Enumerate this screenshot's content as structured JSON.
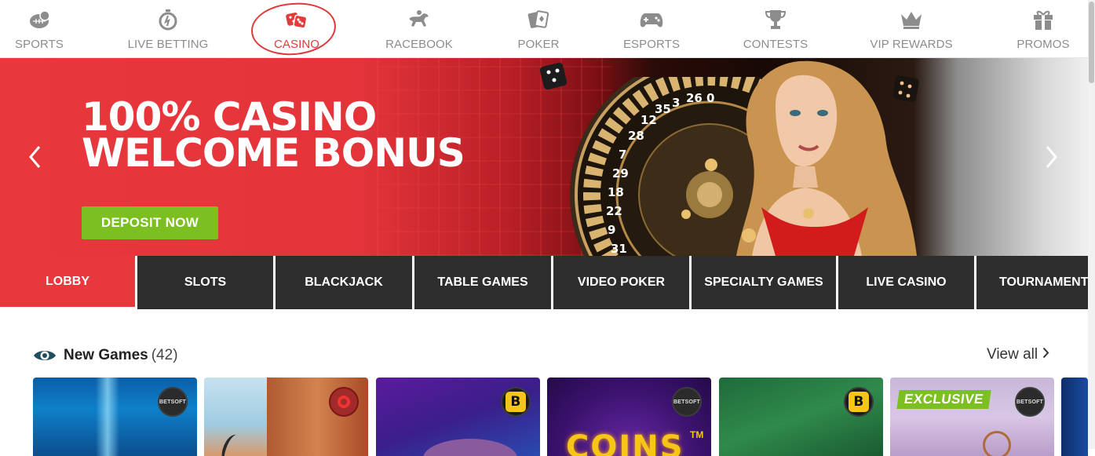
{
  "nav": {
    "items": [
      {
        "label": "SPORTS",
        "icon": "sports-ball-icon"
      },
      {
        "label": "LIVE BETTING",
        "icon": "stopwatch-icon"
      },
      {
        "label": "CASINO",
        "icon": "dice-icon",
        "active": true
      },
      {
        "label": "RACEBOOK",
        "icon": "horse-racing-icon"
      },
      {
        "label": "POKER",
        "icon": "playing-cards-icon"
      },
      {
        "label": "ESPORTS",
        "icon": "gamepad-icon"
      },
      {
        "label": "CONTESTS",
        "icon": "trophy-icon"
      },
      {
        "label": "VIP REWARDS",
        "icon": "crown-icon"
      },
      {
        "label": "PROMOS",
        "icon": "gift-icon"
      }
    ],
    "active_color": "#e23b3b",
    "inactive_color": "#8c8c8c"
  },
  "hero": {
    "title_line1": "100% CASINO",
    "title_line2": "WELCOME BONUS",
    "cta_label": "DEPOSIT NOW",
    "cta_color": "#7cbf20",
    "bg_color": "#e8383c",
    "prev_icon": "chevron-left-icon",
    "next_icon": "chevron-right-icon",
    "roulette_numbers": [
      "0",
      "26",
      "3",
      "35",
      "12",
      "28",
      "7",
      "29",
      "18",
      "22",
      "9",
      "31"
    ]
  },
  "tabs": [
    {
      "label": "LOBBY",
      "active": true
    },
    {
      "label": "SLOTS"
    },
    {
      "label": "BLACKJACK"
    },
    {
      "label": "TABLE GAMES"
    },
    {
      "label": "VIDEO POKER"
    },
    {
      "label": "SPECIALTY GAMES"
    },
    {
      "label": "LIVE CASINO"
    },
    {
      "label": "TOURNAMENTS"
    }
  ],
  "section": {
    "title": "New Games",
    "count": "(42)",
    "view_all": "View all",
    "icon": "eye-icon"
  },
  "cards": [
    {
      "provider": "BETSOFT",
      "badge_type": "betsoft"
    },
    {
      "provider": "",
      "badge_type": "red-ring"
    },
    {
      "provider": "B",
      "badge_type": "b"
    },
    {
      "provider": "BETSOFT",
      "badge_type": "betsoft",
      "art_text": "COINS",
      "art_tm": "TM"
    },
    {
      "provider": "B",
      "badge_type": "b"
    },
    {
      "provider": "BETSOFT",
      "badge_type": "betsoft",
      "ribbon": "EXCLUSIVE"
    }
  ]
}
